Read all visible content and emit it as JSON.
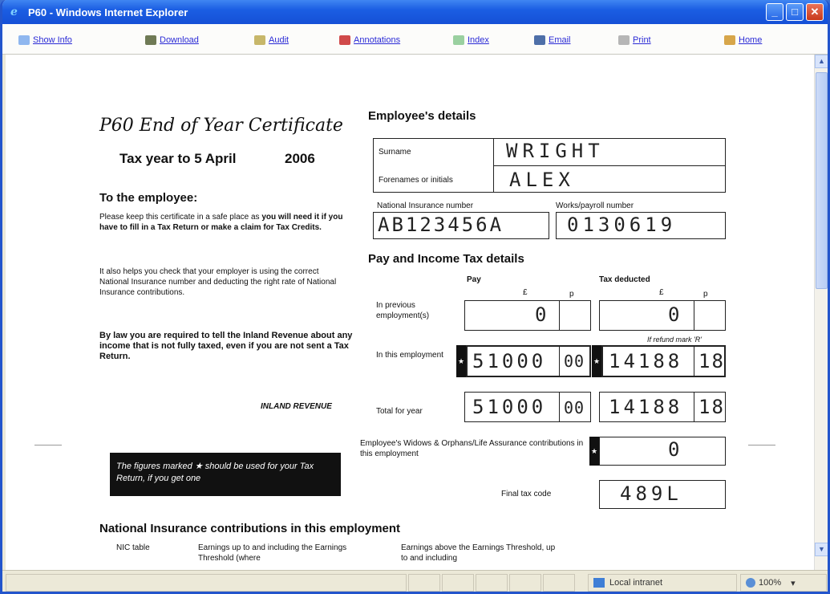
{
  "window": {
    "title": "P60 - Windows Internet Explorer"
  },
  "toolbar": {
    "show_info": "Show Info",
    "download": "Download",
    "audit": "Audit",
    "annotations": "Annotations",
    "index": "Index",
    "email": "Email",
    "print": "Print",
    "home": "Home"
  },
  "status": {
    "zone": "Local intranet",
    "zoom": "100%"
  },
  "form": {
    "title": "P60 End of Year Certificate",
    "tax_year_label": "Tax year to 5 April",
    "tax_year": "2006",
    "to_employee_heading": "To the employee:",
    "para1_normal": "Please keep this certificate in a safe place as ",
    "para1_bold": "you will need it if you have to fill in a Tax Return or make a claim for Tax Credits.",
    "para2": "It also helps you check that your employer is using the correct National Insurance number and deducting the right rate of National Insurance contributions.",
    "para3": "By law you are required to tell the Inland Revenue about any income that is not fully taxed, even if you are not sent a Tax Return.",
    "issuer": "INLAND REVENUE",
    "star_note": "The figures marked ★ should be used for your Tax Return, if you get one",
    "employee_heading": "Employee's details",
    "surname_label": "Surname",
    "surname": "WRIGHT",
    "forenames_label": "Forenames or initials",
    "forenames": "ALEX",
    "ni_label": "National Insurance number",
    "ni_number": "AB123456A",
    "works_label": "Works/payroll number",
    "works_number": "0130619",
    "pay_heading": "Pay and Income Tax details",
    "pay_col": "Pay",
    "tax_col": "Tax deducted",
    "pound": "£",
    "pence": "p",
    "prev_label": "In previous employment(s)",
    "prev_pay": "0",
    "prev_tax": "0",
    "refund_note": "If refund mark 'R'",
    "this_label": "In this employment",
    "this_pay_pounds": "51000",
    "this_pay_pence": "00",
    "this_tax_pounds": "14188",
    "this_tax_pence": "18",
    "total_label": "Total for year",
    "total_pay_pounds": "51000",
    "total_pay_pence": "00",
    "total_tax_pounds": "14188",
    "total_tax_pence": "18",
    "widows_label": "Employee's Widows & Orphans/Life Assurance contributions in this employment",
    "widows_value": "0",
    "taxcode_label": "Final tax code",
    "taxcode": "489L",
    "nic_heading": "National Insurance contributions in this employment",
    "nic_col1": "NIC table",
    "nic_col2": "Earnings up to and including the Earnings Threshold (where",
    "nic_col3": "Earnings above the Earnings Threshold, up to and including"
  }
}
